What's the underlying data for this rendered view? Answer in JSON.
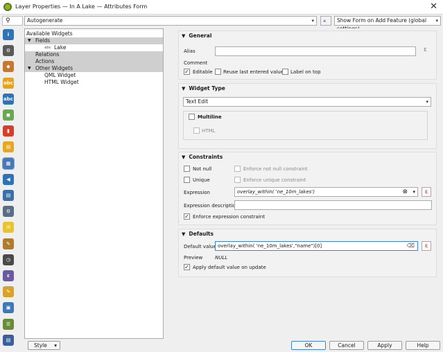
{
  "window": {
    "title": "Layer Properties — In A Lake — Attributes Form",
    "close_glyph": "✕"
  },
  "sidebar": {
    "search_glyph": "⚲",
    "icons": [
      {
        "name": "information-icon",
        "color": "#2f73b7",
        "glyph": "i"
      },
      {
        "name": "source-settings-icon",
        "color": "#5a5a5a",
        "glyph": "⚙"
      },
      {
        "name": "symbology-icon",
        "color": "#c8772e",
        "glyph": "◆"
      },
      {
        "name": "labels-icon",
        "color": "#e7a41a",
        "glyph": "abc"
      },
      {
        "name": "masks-icon",
        "color": "#2f73b7",
        "glyph": "abc"
      },
      {
        "name": "3d-view-icon",
        "color": "#6aa84f",
        "glyph": "◼"
      },
      {
        "name": "diagrams-icon",
        "color": "#d33f2a",
        "glyph": "▮"
      },
      {
        "name": "fields-icon",
        "color": "#e6a820",
        "glyph": "▤"
      },
      {
        "name": "attributes-form-icon",
        "color": "#4a78b4",
        "glyph": "▦"
      },
      {
        "name": "joins-icon",
        "color": "#2f73b7",
        "glyph": "◀"
      },
      {
        "name": "auxiliary-storage-icon",
        "color": "#3b6fa7",
        "glyph": "▤"
      },
      {
        "name": "actions-icon",
        "color": "#5a6c86",
        "glyph": "⚙"
      },
      {
        "name": "display-icon",
        "color": "#e7c430",
        "glyph": "✉"
      },
      {
        "name": "rendering-icon",
        "color": "#b07b2c",
        "glyph": "✎"
      },
      {
        "name": "temporal-icon",
        "color": "#4a4a4a",
        "glyph": "◷"
      },
      {
        "name": "variables-icon",
        "color": "#6b5aa0",
        "glyph": "ε"
      },
      {
        "name": "metadata-icon",
        "color": "#d9a22b",
        "glyph": "✎"
      },
      {
        "name": "dependencies-icon",
        "color": "#3f78b8",
        "glyph": "▣"
      },
      {
        "name": "legend-icon",
        "color": "#6a8c3a",
        "glyph": "☰"
      },
      {
        "name": "qgis-server-icon",
        "color": "#3a5f9a",
        "glyph": "▤"
      }
    ]
  },
  "top": {
    "layout_combo": "Autogenerate",
    "python_glyph": "⚹",
    "form_suppress_combo": "Show Form on Add Feature (global settings)"
  },
  "tree": {
    "root": "Available Widgets",
    "fields_label": "Fields",
    "field_type": "abc",
    "field_name": "Lake",
    "relations": "Relations",
    "actions": "Actions",
    "other_widgets": "Other Widgets",
    "qml_widget": "QML Widget",
    "html_widget": "HTML Widget"
  },
  "general": {
    "header": "General",
    "alias_label": "Alias",
    "alias_value": "",
    "comment_label": "Comment",
    "editable": "Editable",
    "reuse_last": "Reuse last entered value",
    "label_on_top": "Label on top"
  },
  "widget_type": {
    "header": "Widget Type",
    "type": "Text Edit",
    "multiline": "Multiline",
    "html": "HTML"
  },
  "constraints": {
    "header": "Constraints",
    "not_null": "Not null",
    "enforce_not_null": "Enforce not null constraint",
    "unique": "Unique",
    "enforce_unique": "Enforce unique constraint",
    "expression_label": "Expression",
    "expression_value": "overlay_within( 'ne_10m_lakes')",
    "expression_desc_label": "Expression description",
    "expression_desc_value": "",
    "enforce_expression": "Enforce expression constraint"
  },
  "defaults": {
    "header": "Defaults",
    "default_value_label": "Default value",
    "default_value": "overlay_within( 'ne_10m_lakes',\"name\")[0]",
    "preview_label": "Preview",
    "preview_value": "NULL",
    "apply_on_update": "Apply default value on update"
  },
  "footer": {
    "style": "Style",
    "ok": "OK",
    "cancel": "Cancel",
    "apply": "Apply",
    "help": "Help"
  },
  "glyphs": {
    "triangle_down": "▼",
    "triangle_right": "▶",
    "check": "✓",
    "combo_arrow": "▾",
    "epsilon": "ε",
    "clear": "⊗",
    "backspace": "⌫"
  }
}
